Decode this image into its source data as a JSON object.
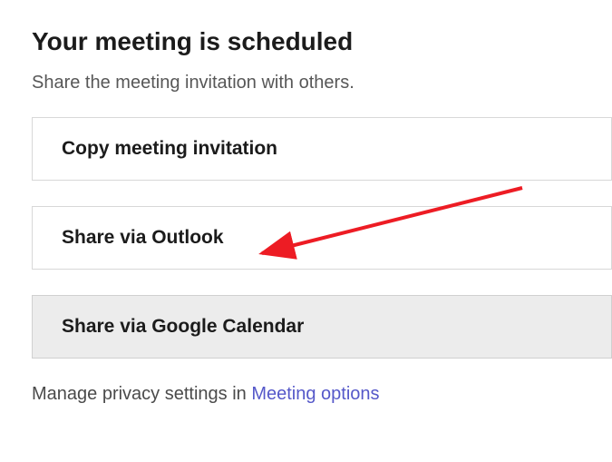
{
  "header": {
    "title": "Your meeting is scheduled",
    "subtitle": "Share the meeting invitation with others."
  },
  "buttons": {
    "copy_invitation": "Copy meeting invitation",
    "share_outlook": "Share via Outlook",
    "share_google": "Share via Google Calendar"
  },
  "footer": {
    "prefix": "Manage privacy settings in ",
    "link_label": "Meeting options"
  },
  "annotation": {
    "arrow_color": "#ed1c24"
  }
}
